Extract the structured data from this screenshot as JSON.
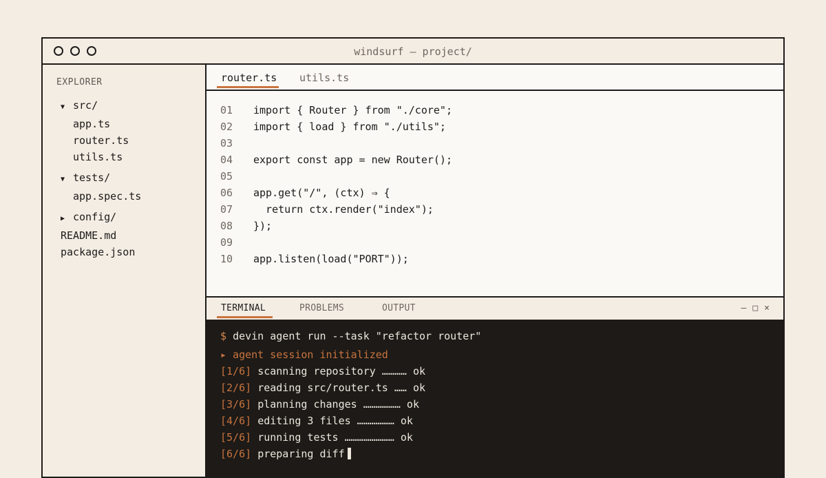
{
  "window": {
    "title": "windsurf — project/"
  },
  "explorer": {
    "label": "EXPLORER",
    "tree": [
      {
        "type": "folder",
        "caret": "▼",
        "name": "src/"
      },
      {
        "type": "file",
        "name": "app.ts"
      },
      {
        "type": "file",
        "name": "router.ts"
      },
      {
        "type": "file",
        "name": "utils.ts"
      },
      {
        "type": "folder",
        "caret": "▼",
        "name": "tests/"
      },
      {
        "type": "file",
        "name": "app.spec.ts"
      },
      {
        "type": "folder",
        "caret": "▶",
        "name": "config/"
      },
      {
        "type": "rootfile",
        "name": "README.md"
      },
      {
        "type": "rootfile",
        "name": "package.json"
      }
    ]
  },
  "editor": {
    "tabs": [
      {
        "label": "router.ts",
        "active": true
      },
      {
        "label": "utils.ts",
        "active": false
      }
    ],
    "lines": [
      {
        "num": "01",
        "code": "import { Router } from \"./core\";"
      },
      {
        "num": "02",
        "code": "import { load } from \"./utils\";"
      },
      {
        "num": "03",
        "code": ""
      },
      {
        "num": "04",
        "code": "export const app = new Router();"
      },
      {
        "num": "05",
        "code": ""
      },
      {
        "num": "06",
        "code": "app.get(\"/\", (ctx) ⇒ {"
      },
      {
        "num": "07",
        "code": "  return ctx.render(\"index\");"
      },
      {
        "num": "08",
        "code": "});"
      },
      {
        "num": "09",
        "code": ""
      },
      {
        "num": "10",
        "code": "app.listen(load(\"PORT\"));"
      }
    ]
  },
  "panel": {
    "tabs": [
      {
        "label": "TERMINAL",
        "active": true
      },
      {
        "label": "PROBLEMS",
        "active": false
      },
      {
        "label": "OUTPUT",
        "active": false
      }
    ],
    "controls": {
      "minimize": "—",
      "maximize": "□",
      "close": "×"
    }
  },
  "terminal": {
    "prompt": "$",
    "command": "devin agent run --task \"refactor router\"",
    "info": "▸ agent session initialized",
    "steps": [
      {
        "tag": "[1/6]",
        "text": "scanning repository ………… ok"
      },
      {
        "tag": "[2/6]",
        "text": "reading src/router.ts …… ok"
      },
      {
        "tag": "[3/6]",
        "text": "planning changes ……………… ok"
      },
      {
        "tag": "[4/6]",
        "text": "editing 3 files ……………… ok"
      },
      {
        "tag": "[5/6]",
        "text": "running tests …………………… ok"
      },
      {
        "tag": "[6/6]",
        "text": "preparing diff"
      }
    ]
  }
}
